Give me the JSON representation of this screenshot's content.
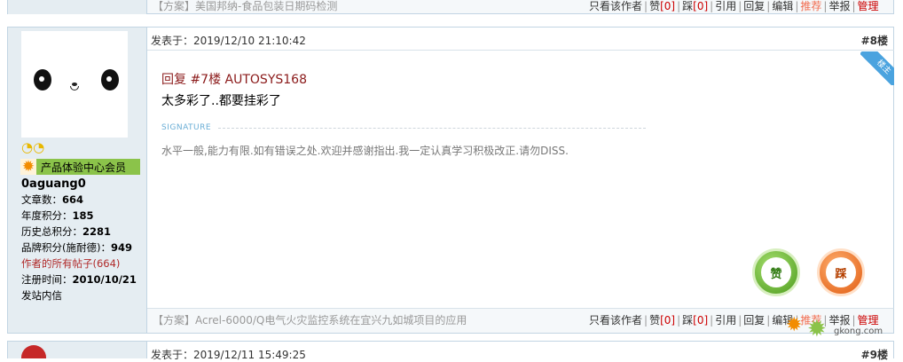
{
  "prev_post": {
    "plan_text": "【方案】美国邦纳-食品包装日期码检测",
    "actions": [
      "只看该作者",
      "赞",
      "[0]",
      "踩",
      "[0]",
      "引用",
      "回复",
      "编辑",
      "推荐",
      "举报",
      "管理"
    ]
  },
  "post8": {
    "user": {
      "level_icons": "◔◔",
      "group": "产品体验中心会员",
      "name": "0aguang0",
      "stats": [
        {
          "label": "文章数：",
          "value": "664"
        },
        {
          "label": "年度积分：",
          "value": "185"
        },
        {
          "label": "历史总积分：",
          "value": "2281"
        },
        {
          "label": "品牌积分(施耐德)：",
          "value": "949"
        }
      ],
      "all_posts": "作者的所有帖子(664)",
      "register_label": "注册时间：",
      "register_date": "2010/10/21",
      "send_message": "发站内信"
    },
    "posted_at": "发表于：2019/12/10 21:10:42",
    "floor": "#8楼",
    "ribbon": "楼主",
    "reply_to": "回复 #7楼 AUTOSYS168",
    "content": "太多彩了..都要挂彩了",
    "signature_label": "SIGNATURE",
    "signature": "水平一般,能力有限.如有错误之处.欢迎并感谢指出.我一定认真学习积极改正.请勿DISS.",
    "like_label": "赞",
    "dislike_label": "踩",
    "footer_plan": "【方案】Acrel-6000/Q电气火灾监控系统在宜兴九如城项目的应用",
    "footer_actions": [
      "只看该作者",
      "赞",
      "[0]",
      "踩",
      "[0]",
      "引用",
      "回复",
      "编辑",
      "推荐",
      "举报",
      "管理"
    ]
  },
  "watermark": "gkong.com",
  "post9": {
    "posted_at": "发表于：2019/12/11 15:49:25",
    "floor": "#9楼"
  }
}
